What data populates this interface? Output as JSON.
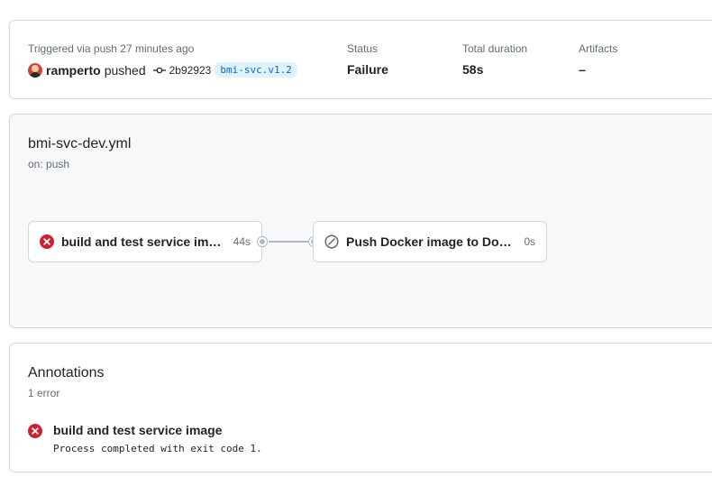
{
  "summary": {
    "trigger_label": "Triggered via push 27 minutes ago",
    "actor": "ramperto",
    "action": "pushed",
    "commit_sha": "2b92923",
    "branch": "bmi-svc.v1.2",
    "status_label": "Status",
    "status_value": "Failure",
    "duration_label": "Total duration",
    "duration_value": "58s",
    "artifacts_label": "Artifacts",
    "artifacts_value": "–"
  },
  "workflow": {
    "file": "bmi-svc-dev.yml",
    "trigger": "on: push",
    "jobs": [
      {
        "title": "build and test service image",
        "duration": "44s",
        "status": "failure",
        "icon": "x-circle-fill-icon"
      },
      {
        "title": "Push Docker image to Docke...",
        "duration": "0s",
        "status": "skipped",
        "icon": "skip-icon"
      }
    ]
  },
  "annotations": {
    "title": "Annotations",
    "count": "1 error",
    "items": [
      {
        "title": "build and test service image",
        "message": "Process completed with exit code 1.",
        "icon": "x-circle-fill-icon"
      }
    ]
  },
  "colors": {
    "failure": "#cf222e",
    "muted": "#636c76",
    "border": "#d0d7de",
    "branch_bg": "#ddf4ff",
    "branch_fg": "#0969da"
  }
}
